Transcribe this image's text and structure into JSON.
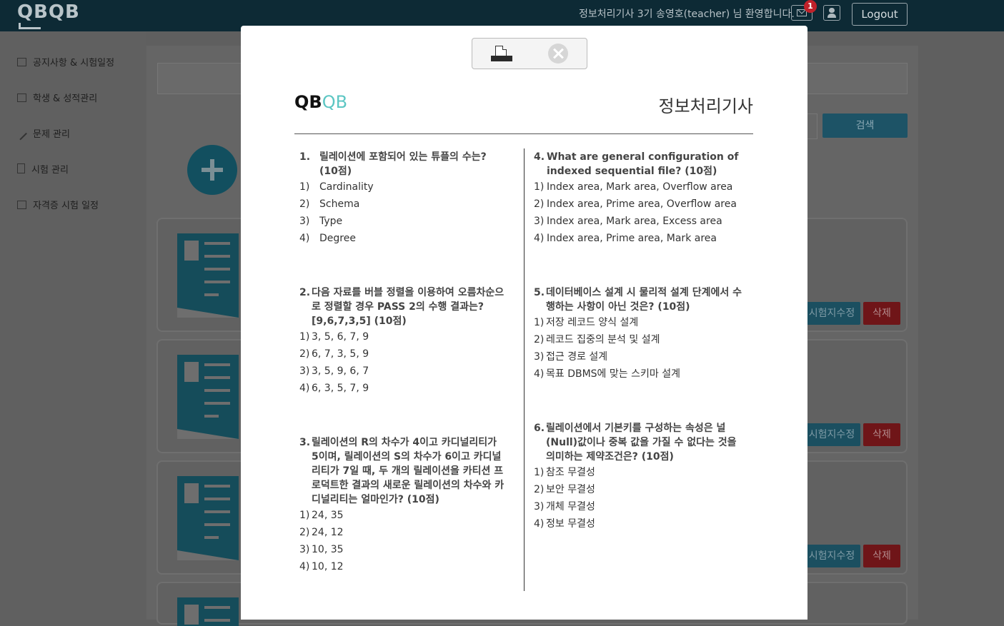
{
  "header": {
    "logo": "QBQB",
    "welcome": "정보처리기사 3기 송영호(teacher) 님 환영합니다.",
    "mail_badge": "1",
    "logout": "Logout",
    "icons": [
      "mail-icon",
      "user-icon"
    ]
  },
  "sidebar": {
    "items": [
      {
        "label": "공지사항 & 시험일정",
        "icon": "calendar-icon"
      },
      {
        "label": "학생 & 성적관리",
        "icon": "book-icon"
      },
      {
        "label": "문제 관리",
        "icon": "pencil-icon"
      },
      {
        "label": "시험 관리",
        "icon": "file-icon"
      },
      {
        "label": "자격증 시험 일정",
        "icon": "calendar-icon"
      }
    ]
  },
  "main": {
    "search_button": "검색",
    "card_buttons": {
      "edit": "시험지수정",
      "delete": "삭제"
    }
  },
  "modal": {
    "brand_a": "QB",
    "brand_b": "QB",
    "exam_title": "정보처리기사",
    "questions": [
      {
        "num": "1.",
        "stem": "릴레이션에 포함되어 있는 튜플의 수는? (10점)",
        "options": [
          {
            "n": "1)",
            "t": "Cardinality"
          },
          {
            "n": "2)",
            "t": "Schema"
          },
          {
            "n": "3)",
            "t": "Type"
          },
          {
            "n": "4)",
            "t": "Degree"
          }
        ]
      },
      {
        "num": "2.",
        "stem": "다음 자료를 버블 정렬을 이용하여 오름차순으로 정렬할 경우 PASS 2의 수행 결과는? [9,6,7,3,5] (10점)",
        "options": [
          {
            "n": "1)",
            "t": "3, 5, 6, 7, 9"
          },
          {
            "n": "2)",
            "t": "6, 7, 3, 5, 9"
          },
          {
            "n": "3)",
            "t": "3, 5, 9, 6, 7"
          },
          {
            "n": "4)",
            "t": "6, 3, 5, 7, 9"
          }
        ]
      },
      {
        "num": "3.",
        "stem": "릴레이션의 R의 차수가 4이고 카디널리티가 5이며, 릴레이션의 S의 차수가 6이고 카디널리티가 7일 때, 두 개의 릴레이션을 카티션 프로덕트한 결과의 새로운 릴레이션의 차수와 카디널리티는 얼마인가? (10점)",
        "options": [
          {
            "n": "1)",
            "t": "24, 35"
          },
          {
            "n": "2)",
            "t": "24, 12"
          },
          {
            "n": "3)",
            "t": "10, 35"
          },
          {
            "n": "4)",
            "t": "10, 12"
          }
        ]
      },
      {
        "num": "4.",
        "stem": "What are general configuration of indexed sequential file? (10점)",
        "options": [
          {
            "n": "1)",
            "t": "Index area, Mark area, Overflow area"
          },
          {
            "n": "2)",
            "t": "Index area, Prime area, Overflow area"
          },
          {
            "n": "3)",
            "t": "Index area, Mark area, Excess area"
          },
          {
            "n": "4)",
            "t": "Index area, Prime area, Mark area"
          }
        ]
      },
      {
        "num": "5.",
        "stem": "데이터베이스 설계 시 물리적 설계 단계에서 수행하는 사항이 아닌 것은? (10점)",
        "options": [
          {
            "n": "1)",
            "t": "저장 레코드 양식 설계"
          },
          {
            "n": "2)",
            "t": "레코드 집중의 분석 및 설계"
          },
          {
            "n": "3)",
            "t": "접근 경로 설계"
          },
          {
            "n": "4)",
            "t": "목표 DBMS에 맞는 스키마 설계"
          }
        ]
      },
      {
        "num": "6.",
        "stem": "릴레이션에서 기본키를 구성하는 속성은 널(Null)값이나 중복 값을 가질 수 없다는 것을 의미하는 제약조건은? (10점)",
        "options": [
          {
            "n": "1)",
            "t": "참조 무결성"
          },
          {
            "n": "2)",
            "t": "보안 무결성"
          },
          {
            "n": "3)",
            "t": "개체 무결성"
          },
          {
            "n": "4)",
            "t": "정보 무결성"
          }
        ]
      }
    ],
    "icons": [
      "printer-icon",
      "close-icon"
    ]
  },
  "colors": {
    "accent": "#5cc6c3",
    "header_bg": "#0d2a35",
    "delete": "#c9302c",
    "primary": "#2a7f94"
  }
}
